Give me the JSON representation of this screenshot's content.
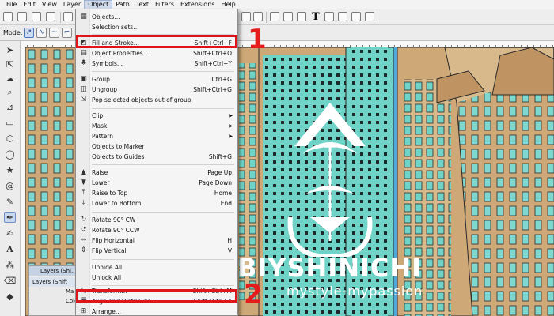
{
  "menubar": {
    "items": [
      "File",
      "Edit",
      "View",
      "Layer",
      "Object",
      "Path",
      "Text",
      "Filters",
      "Extensions",
      "Help"
    ]
  },
  "toolctrl": {
    "mode_label": "Mode:"
  },
  "object_menu": {
    "items": [
      {
        "label": "Objects...",
        "shortcut": "",
        "icon": "objects-icon"
      },
      {
        "label": "Selection sets...",
        "shortcut": "",
        "icon": ""
      },
      {
        "label": "Fill and Stroke...",
        "shortcut": "Shift+Ctrl+F",
        "icon": "fill-stroke-icon"
      },
      {
        "label": "Object Properties...",
        "shortcut": "Shift+Ctrl+O",
        "icon": "object-properties-icon"
      },
      {
        "label": "Symbols...",
        "shortcut": "Shift+Ctrl+Y",
        "icon": "symbols-icon"
      },
      {
        "label": "Group",
        "shortcut": "Ctrl+G",
        "icon": "group-icon"
      },
      {
        "label": "Ungroup",
        "shortcut": "Shift+Ctrl+G",
        "icon": "ungroup-icon"
      },
      {
        "label": "Pop selected objects out of group",
        "shortcut": "",
        "icon": "pop-out-icon"
      },
      {
        "label": "Clip",
        "shortcut": "",
        "icon": "",
        "submenu": true
      },
      {
        "label": "Mask",
        "shortcut": "",
        "icon": "",
        "submenu": true
      },
      {
        "label": "Pattern",
        "shortcut": "",
        "icon": "",
        "submenu": true
      },
      {
        "label": "Objects to Marker",
        "shortcut": "",
        "icon": ""
      },
      {
        "label": "Objects to Guides",
        "shortcut": "Shift+G",
        "icon": ""
      },
      {
        "label": "Raise",
        "shortcut": "Page Up",
        "icon": "raise-icon"
      },
      {
        "label": "Lower",
        "shortcut": "Page Down",
        "icon": "lower-icon"
      },
      {
        "label": "Raise to Top",
        "shortcut": "Home",
        "icon": "raise-to-top-icon"
      },
      {
        "label": "Lower to Bottom",
        "shortcut": "End",
        "icon": "lower-to-bottom-icon"
      },
      {
        "label": "Rotate 90° CW",
        "shortcut": "",
        "icon": "rotate-cw-icon"
      },
      {
        "label": "Rotate 90° CCW",
        "shortcut": "",
        "icon": "rotate-ccw-icon"
      },
      {
        "label": "Flip Horizontal",
        "shortcut": "H",
        "icon": "flip-horizontal-icon"
      },
      {
        "label": "Flip Vertical",
        "shortcut": "V",
        "icon": "flip-vertical-icon"
      },
      {
        "label": "Unhide All",
        "shortcut": "",
        "icon": ""
      },
      {
        "label": "Unlock All",
        "shortcut": "",
        "icon": ""
      },
      {
        "label": "Transform...",
        "shortcut": "Shift+Ctrl+M",
        "icon": "transform-icon"
      },
      {
        "label": "Align and Distribute...",
        "shortcut": "Shift+Ctrl+A",
        "icon": "align-icon"
      },
      {
        "label": "Arrange...",
        "shortcut": "",
        "icon": "arrange-icon"
      }
    ]
  },
  "annotations": {
    "marker_1": "1",
    "marker_2": "2"
  },
  "layers_panel": {
    "title": "Layers (Shi...",
    "inner_title": "Layers (Shift",
    "rows": [
      "Ma",
      "Colo"
    ]
  },
  "watermark": {
    "brand": "BIYSHINICHI",
    "tagline": "mystyle-mypassion"
  },
  "colors": {
    "highlight": "#e0151b",
    "sky": "#4fa9d6",
    "building_tan": "#d8b98c",
    "window_teal": "#6fd3c7"
  }
}
